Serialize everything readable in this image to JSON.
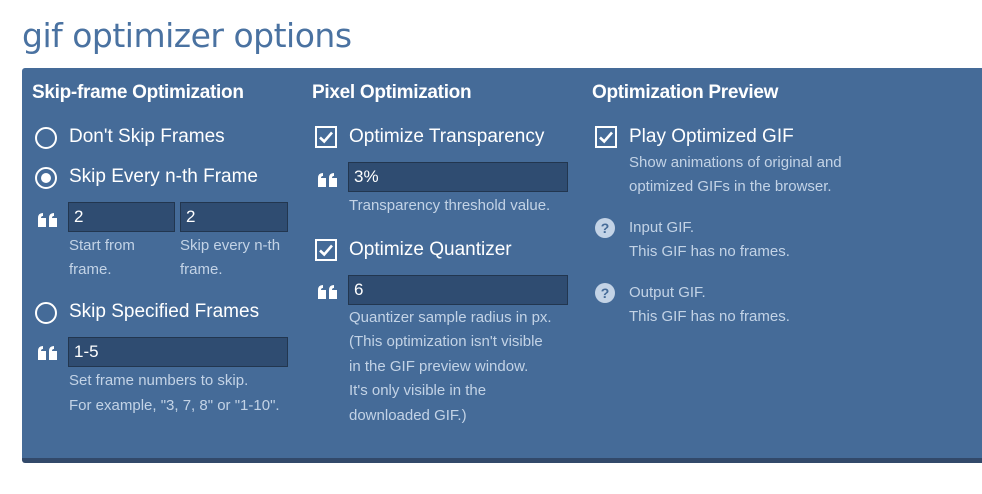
{
  "page": {
    "title": "gif optimizer options"
  },
  "skip_frame": {
    "title": "Skip-frame Optimization",
    "options": [
      {
        "label": "Don't Skip Frames",
        "checked": false
      },
      {
        "label": "Skip Every n-th Frame",
        "checked": true
      },
      {
        "label": "Skip Specified Frames",
        "checked": false
      }
    ],
    "start_from": {
      "value": "2",
      "hint_line1": "Start from",
      "hint_line2": "frame."
    },
    "skip_every": {
      "value": "2",
      "hint_line1": "Skip every n-th",
      "hint_line2": "frame."
    },
    "frames": {
      "value": "1-5",
      "hint_line1": "Set frame numbers to skip.",
      "hint_line2": "For example, \"3, 7, 8\" or \"1-10\"."
    }
  },
  "pixel": {
    "title": "Pixel Optimization",
    "transparency": {
      "label": "Optimize Transparency",
      "checked": true,
      "value": "3%",
      "hint": "Transparency threshold value."
    },
    "quantizer": {
      "label": "Optimize Quantizer",
      "checked": true,
      "value": "6",
      "hint_lines": [
        "Quantizer sample radius in px.",
        "(This optimization isn't visible",
        "in the GIF preview window.",
        "It's only visible in the",
        "downloaded GIF.)"
      ]
    }
  },
  "preview": {
    "title": "Optimization Preview",
    "play": {
      "label": "Play Optimized GIF",
      "checked": true,
      "hint_line1": "Show animations of original and",
      "hint_line2": "optimized GIFs in the browser."
    },
    "input": {
      "label": "Input GIF.",
      "status": "This GIF has no frames.",
      "icon": "?"
    },
    "output": {
      "label": "Output GIF.",
      "status": "This GIF has no frames.",
      "icon": "?"
    }
  },
  "colors": {
    "panel": "#456b98",
    "field": "#2f4c71",
    "title": "#4a72a1",
    "hint": "#c3d3e6"
  }
}
